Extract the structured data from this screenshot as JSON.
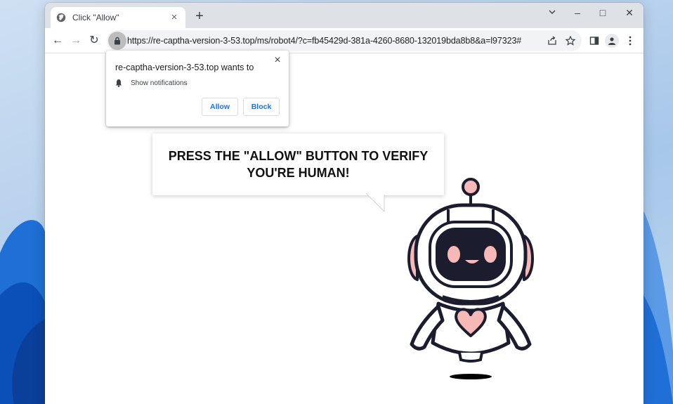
{
  "tab": {
    "title": "Click \"Allow\"",
    "favicon": "globe-icon",
    "close_icon": "×"
  },
  "tabstrip": {
    "new_tab_icon": "+"
  },
  "window_controls": {
    "minimize": "–",
    "maximize": "□",
    "close": "✕"
  },
  "toolbar": {
    "back_icon": "←",
    "forward_icon": "→",
    "reload_icon": "↻",
    "url": "https://re-captha-version-3-53.top/ms/robot4/?c=fb45429d-381a-4260-8680-132019bda8b8&a=l97323#"
  },
  "permission_popup": {
    "title": "re-captha-version-3-53.top wants to",
    "permission_label": "Show notifications",
    "permission_icon": "bell-icon",
    "close_icon": "×",
    "allow_label": "Allow",
    "block_label": "Block"
  },
  "page": {
    "message": "PRESS THE \"ALLOW\" BUTTON TO VERIFY\nYOU'RE HUMAN!"
  },
  "colors": {
    "accent_blue": "#1a73e8",
    "robot_pink": "#f7b8b8",
    "robot_dark": "#1b1d2e"
  }
}
